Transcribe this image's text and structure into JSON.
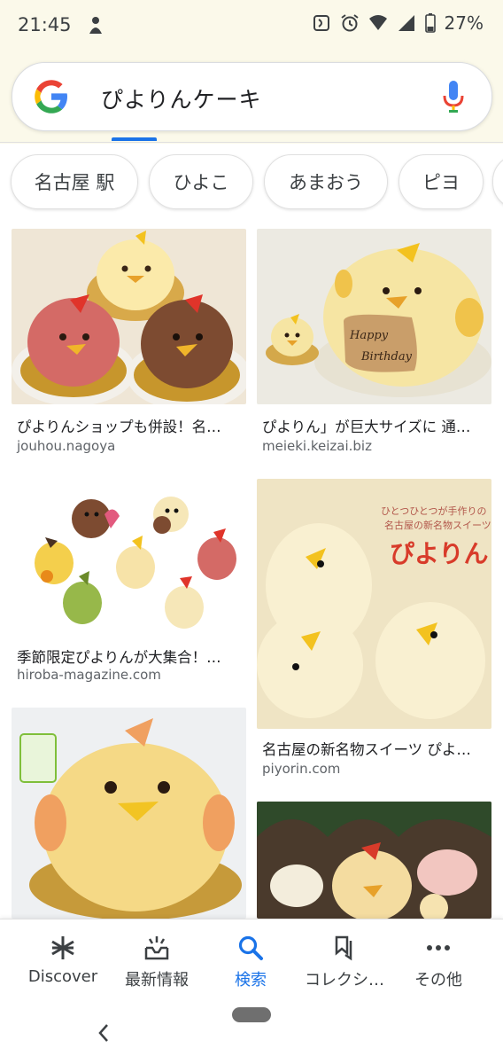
{
  "status_bar": {
    "time": "21:45",
    "battery_percent": "27%",
    "icons": [
      "notification-icon",
      "nfc-icon",
      "alarm-icon",
      "wifi-icon",
      "signal-icon",
      "battery-icon"
    ]
  },
  "search": {
    "query": "ぴよりんケーキ",
    "icons": [
      "google-logo-icon",
      "microphone-icon"
    ]
  },
  "chips": [
    "名古屋 駅",
    "ひよこ",
    "あまおう",
    "ピヨ"
  ],
  "results": [
    {
      "title": "ぴよりんショップも併設！名…",
      "domain": "jouhou.nagoya"
    },
    {
      "title": "ぴよりん」が巨大サイズに 通…",
      "domain": "meieki.keizai.biz"
    },
    {
      "title": "季節限定ぴよりんが大集合！…",
      "domain": "hiroba-magazine.com"
    },
    {
      "title": "名古屋の新名物スイーツ ぴよ…",
      "domain": "piyorin.com"
    }
  ],
  "images": {
    "cake_text_1": "Happy",
    "cake_text_2": "Birthday",
    "ad_line_1": "ひとつひとつが手作りの",
    "ad_line_2": "名古屋の新名物スイーツ",
    "ad_logo": "ぴよりん"
  },
  "bottom_nav": [
    {
      "label": "Discover",
      "icon": "asterisk-icon"
    },
    {
      "label": "最新情報",
      "icon": "updates-icon"
    },
    {
      "label": "検索",
      "icon": "search-icon",
      "active": true
    },
    {
      "label": "コレクシ…",
      "icon": "collections-icon"
    },
    {
      "label": "その他",
      "icon": "more-icon"
    }
  ],
  "colors": {
    "accent": "#1a73e8",
    "status_bg": "#fbf9ea",
    "text_secondary": "#5f6368"
  }
}
